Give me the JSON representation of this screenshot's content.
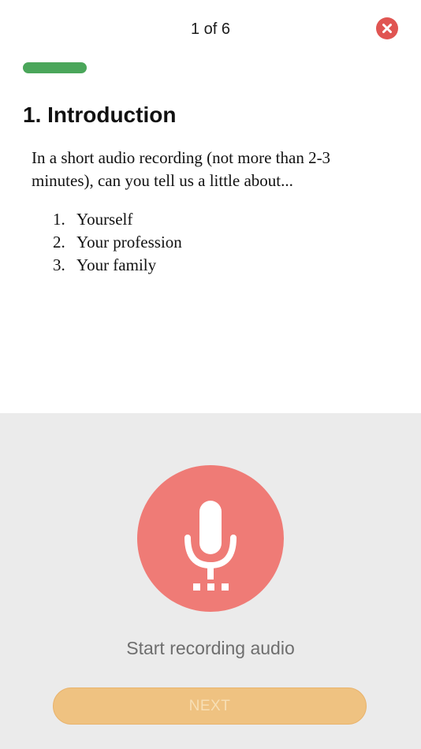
{
  "header": {
    "progress_text": "1 of 6",
    "progress_fraction": 0.17
  },
  "question": {
    "title": "1. Introduction",
    "body": "In a short audio recording (not more than 2-3 minutes), can you tell us a little about...",
    "items": [
      {
        "number": "1.",
        "text": "Yourself"
      },
      {
        "number": "2.",
        "text": "Your profession"
      },
      {
        "number": "3.",
        "text": "Your family"
      }
    ]
  },
  "recorder": {
    "label": "Start recording audio",
    "icon": "microphone-icon"
  },
  "footer": {
    "next_label": "NEXT"
  },
  "colors": {
    "progress": "#4aa65a",
    "close": "#e05552",
    "record": "#ef7b76",
    "next_button": "#efc281",
    "bottom_background": "#ebebeb"
  }
}
